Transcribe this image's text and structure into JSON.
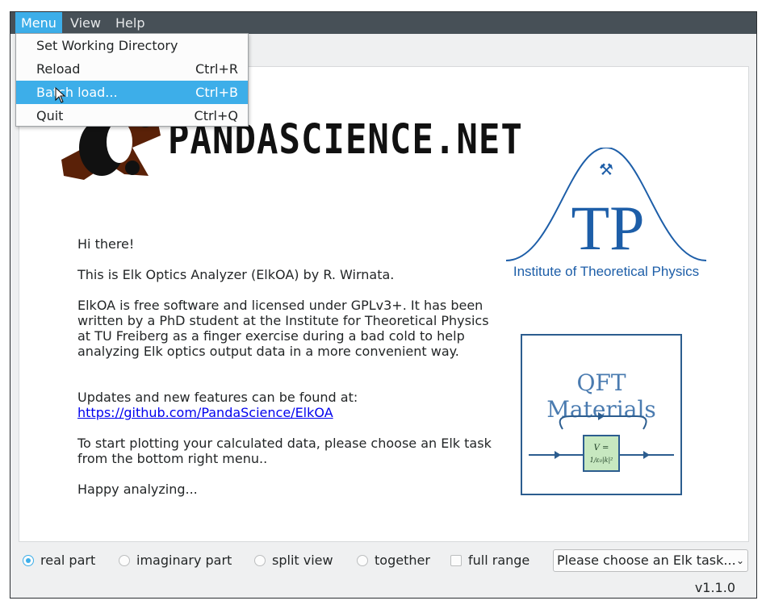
{
  "menubar": {
    "items": [
      "Menu",
      "View",
      "Help"
    ]
  },
  "dropdown": {
    "items": [
      {
        "label": "Set Working Directory",
        "shortcut": ""
      },
      {
        "label": "Reload",
        "shortcut": "Ctrl+R"
      },
      {
        "label": "Batch load...",
        "shortcut": "Ctrl+B"
      },
      {
        "label": "Quit",
        "shortcut": "Ctrl+Q"
      }
    ]
  },
  "content": {
    "logo_text": "PANDASCIENCE.NET",
    "greeting": "Hi there!",
    "intro": "This is Elk Optics Analyzer (ElkOA) by R. Wirnata.",
    "description": "ElkOA is free software and licensed under GPLv3+. It has been written by a PhD student at the Institute for Theoretical Physics at TU Freiberg as a finger exercise during a bad cold to help analyzing Elk optics output data in a more convenient way.",
    "updates_label": "Updates and new features can be found at:",
    "link": "https://github.com/PandaScience/ElkOA",
    "instructions": "To start plotting your calculated data, please choose an Elk task from the bottom right menu..",
    "closing": "Happy analyzing...",
    "itp_caption": "Institute of Theoretical Physics",
    "itp_letters": "TP",
    "qft_title": "QFT Materials",
    "qft_formula_top": "V =",
    "qft_formula_bottom": "1/ε₀|k|²"
  },
  "bottom": {
    "radios": [
      "real part",
      "imaginary part",
      "split view",
      "together"
    ],
    "selected_radio": "real part",
    "checkbox": "full range",
    "checkbox_checked": false,
    "task_select": "Please choose an Elk task..."
  },
  "version": "v1.1.0",
  "colors": {
    "accent": "#3daee9",
    "menubar": "#475057",
    "itp_blue": "#1d5ea8"
  }
}
